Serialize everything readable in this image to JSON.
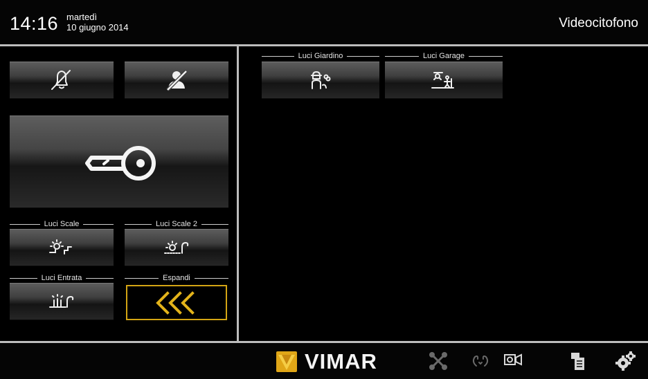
{
  "header": {
    "time": "14:16",
    "day": "martedì",
    "date": "10 giugno 2014",
    "title": "Videocitofono"
  },
  "left_panel": {
    "top_buttons": [
      {
        "icon": "bell-muted-icon"
      },
      {
        "icon": "user-off-icon"
      }
    ],
    "door_button": {
      "icon": "key-icon"
    },
    "labeled_buttons": [
      {
        "label": "Luci Scale",
        "icon": "stair-light-icon"
      },
      {
        "label": "Luci Scale 2",
        "icon": "light-hand-icon"
      },
      {
        "label": "Luci Entrata",
        "icon": "entrance-light-icon"
      },
      {
        "label": "Espandi",
        "icon": "expand-chevrons-icon",
        "active": true
      }
    ]
  },
  "right_panel": {
    "buttons": [
      {
        "label": "Luci Giardino",
        "icon": "garden-light-icon"
      },
      {
        "label": "Luci Garage",
        "icon": "garage-light-icon"
      }
    ]
  },
  "footer": {
    "brand": "VIMAR",
    "icons": [
      "call-transfer-icon",
      "intercom-icon",
      "camera-icon",
      "memo-icon",
      "settings-icon"
    ]
  },
  "colors": {
    "accent": "#d4a514",
    "separator": "#bdbdbd",
    "background": "#000000"
  }
}
